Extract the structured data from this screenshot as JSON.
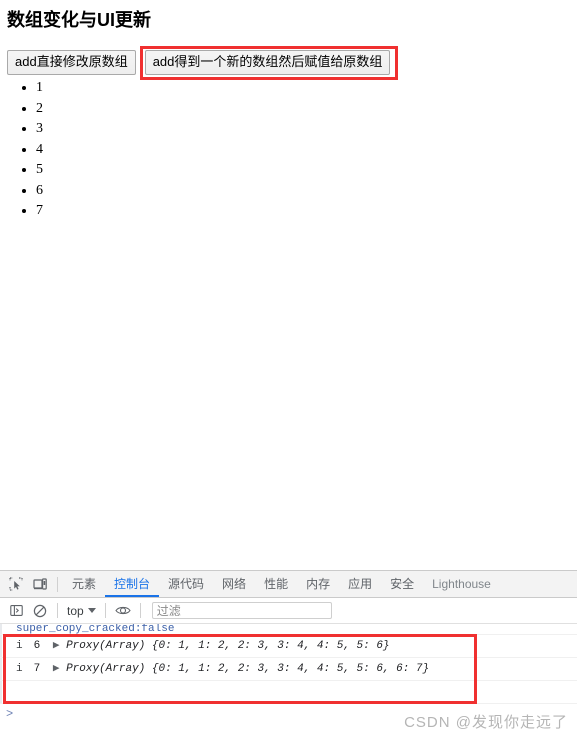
{
  "page": {
    "title": "数组变化与UI更新",
    "buttons": [
      {
        "label": "add直接修改原数组",
        "name": "add-mutate-original-button"
      },
      {
        "label": "add得到一个新的数组然后赋值给原数组",
        "name": "add-new-array-assign-button"
      }
    ],
    "list_items": [
      "1",
      "2",
      "3",
      "4",
      "5",
      "6",
      "7"
    ],
    "highlight_color": "#f03030"
  },
  "devtools": {
    "icons": {
      "inspect": "inspect-element-icon",
      "device": "device-toolbar-icon",
      "sidebar": "console-sidebar-icon",
      "clear": "clear-console-icon",
      "eye": "live-expression-eye-icon"
    },
    "tabs": [
      {
        "label": "元素",
        "active": false
      },
      {
        "label": "控制台",
        "active": true
      },
      {
        "label": "源代码",
        "active": false
      },
      {
        "label": "网络",
        "active": false
      },
      {
        "label": "性能",
        "active": false
      },
      {
        "label": "内存",
        "active": false
      },
      {
        "label": "应用",
        "active": false
      },
      {
        "label": "安全",
        "active": false
      },
      {
        "label": "Lighthouse",
        "active": false
      }
    ],
    "console_toolbar": {
      "context": "top",
      "filter_placeholder": "过滤",
      "filter_value": ""
    },
    "console": {
      "clipped_line": "super_copy_cracked:false",
      "entries": [
        {
          "icon": "i",
          "count": "6",
          "disclosure": "▶",
          "type": "Proxy(Array)",
          "body": "{0: 1, 1: 2, 2: 3, 3: 4, 4: 5, 5: 6}"
        },
        {
          "icon": "i",
          "count": "7",
          "disclosure": "▶",
          "type": "Proxy(Array)",
          "body": "{0: 1, 1: 2, 2: 3, 3: 4, 4: 5, 5: 6, 6: 7}"
        }
      ],
      "prompt": ">"
    },
    "accent_color": "#1a73e8"
  },
  "watermark": "CSDN @发现你走远了"
}
